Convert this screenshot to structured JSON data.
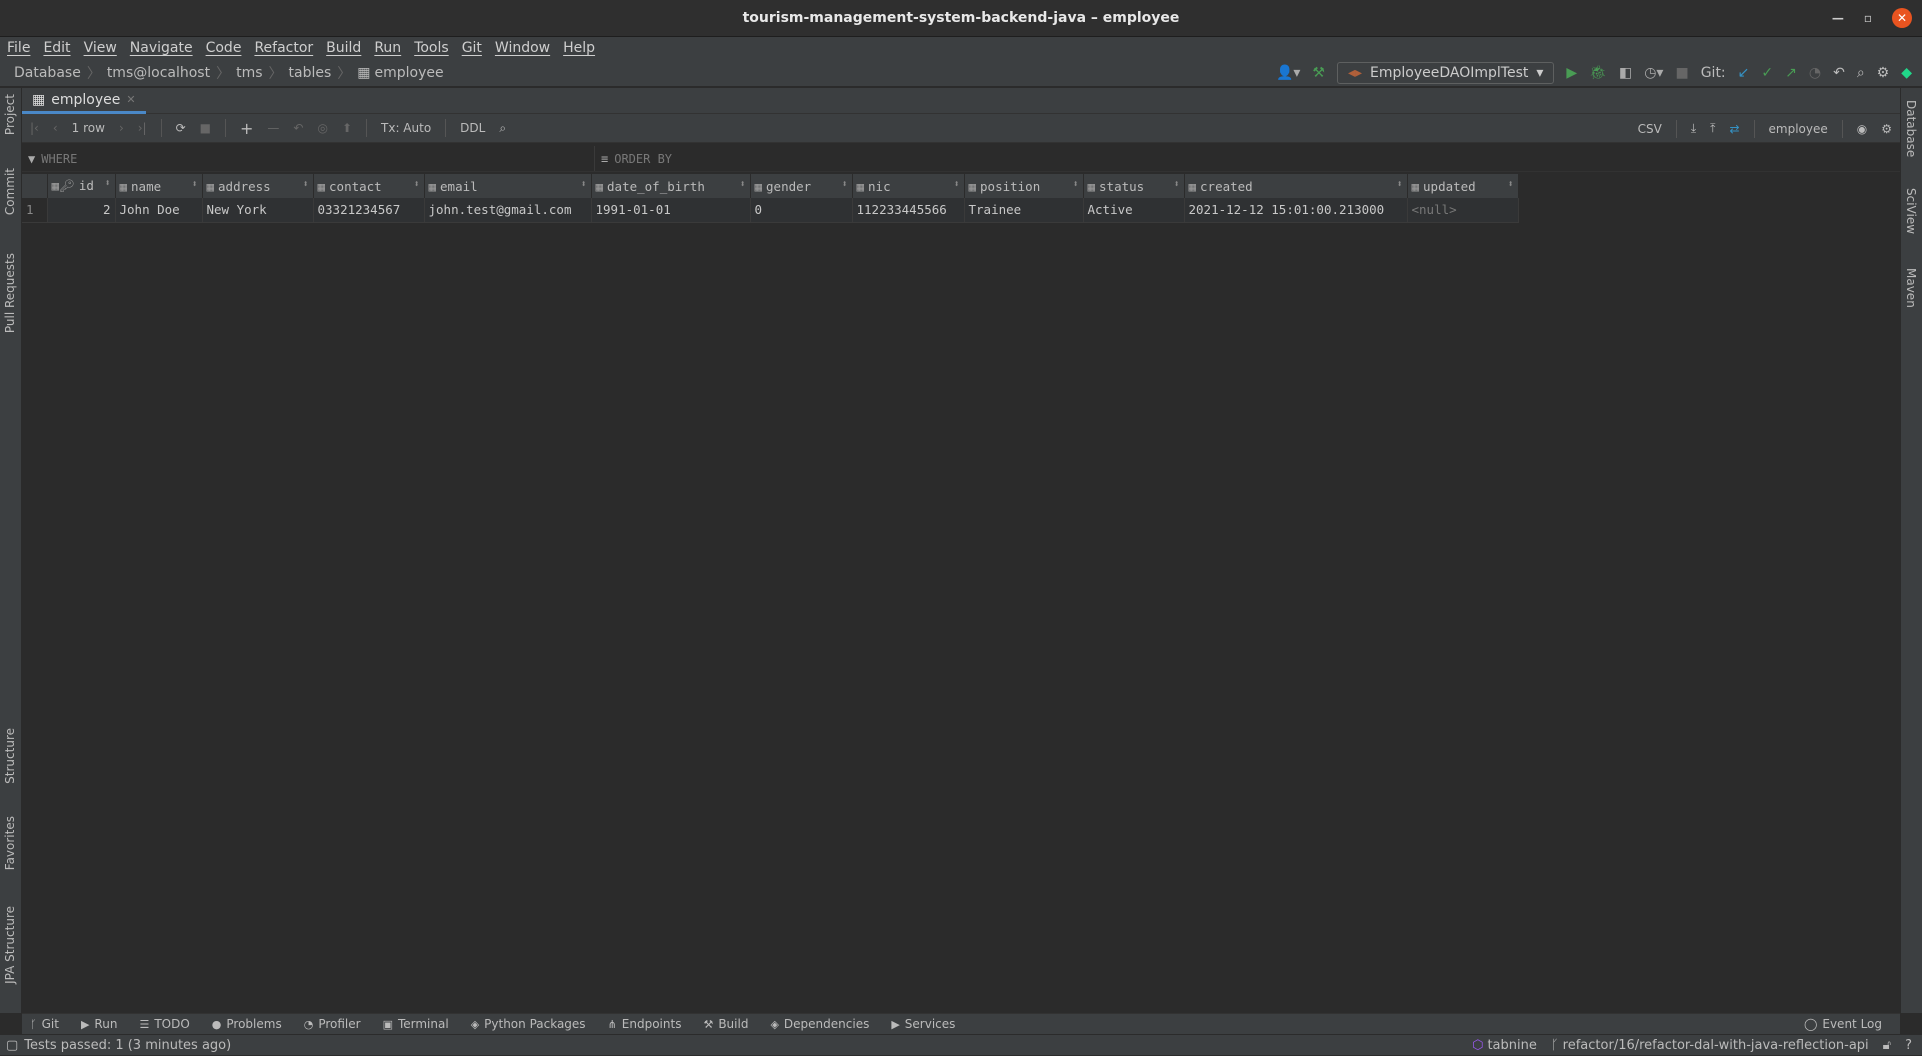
{
  "window": {
    "title": "tourism-management-system-backend-java – employee"
  },
  "menu": [
    "File",
    "Edit",
    "View",
    "Navigate",
    "Code",
    "Refactor",
    "Build",
    "Run",
    "Tools",
    "Git",
    "Window",
    "Help"
  ],
  "breadcrumb": [
    "Database",
    "tms@localhost",
    "tms",
    "tables",
    "employee"
  ],
  "run_config": "EmployeeDAOImplTest",
  "git_label": "Git:",
  "tab": {
    "label": "employee"
  },
  "toolbar": {
    "rows": "1 row",
    "tx": "Tx: Auto",
    "ddl": "DDL",
    "export": "CSV",
    "schema": "employee"
  },
  "filters": {
    "where": "WHERE",
    "order_by": "ORDER BY"
  },
  "table": {
    "columns": [
      "id",
      "name",
      "address",
      "contact",
      "email",
      "date_of_birth",
      "gender",
      "nic",
      "position",
      "status",
      "created",
      "updated"
    ],
    "rows": [
      {
        "num": "1",
        "cells": [
          "2",
          "John Doe",
          "New York",
          "03321234567",
          "john.test@gmail.com",
          "1991-01-01",
          "0",
          "112233445566",
          "Trainee",
          "Active",
          "2021-12-12 15:01:00.213000",
          "<null>"
        ]
      }
    ]
  },
  "left_tools": [
    "Project",
    "Commit",
    "Pull Requests",
    "Structure",
    "Favorites",
    "JPA Structure"
  ],
  "right_tools": [
    "Database",
    "SciView",
    "Maven"
  ],
  "bottom_tools": [
    "Git",
    "Run",
    "TODO",
    "Problems",
    "Profiler",
    "Terminal",
    "Python Packages",
    "Endpoints",
    "Build",
    "Dependencies",
    "Services"
  ],
  "event_log": "Event Log",
  "status": {
    "message": "Tests passed: 1 (3 minutes ago)",
    "plugin": "tabnine",
    "branch": "refactor/16/refactor-dal-with-java-reflection-api"
  },
  "colors": {
    "accent": "#4a88c7",
    "run": "#499c54",
    "close": "#e95420"
  }
}
